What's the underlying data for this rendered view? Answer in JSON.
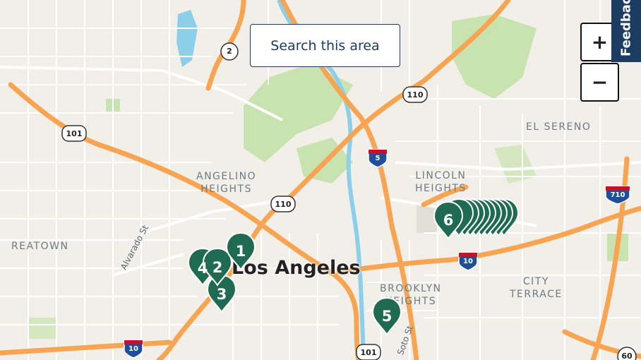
{
  "search_button": {
    "label": "Search this area"
  },
  "zoom": {
    "in_label": "+",
    "out_label": "−"
  },
  "feedback": {
    "label": "Feedback"
  },
  "city_label": "Los Angeles",
  "neighborhoods": [
    {
      "line1": "EL SERENO",
      "line2": ""
    },
    {
      "line1": "ANGELINO",
      "line2": "HEIGHTS"
    },
    {
      "line1": "LINCOLN",
      "line2": "HEIGHTS"
    },
    {
      "line1": "BROOKLYN",
      "line2": "HEIGHTS"
    },
    {
      "line1": "CITY",
      "line2": "TERRACE"
    },
    {
      "line1": "REATOWN",
      "line2": ""
    }
  ],
  "streets": [
    "Alvarado St",
    "Soto St"
  ],
  "highway_shields": [
    "2",
    "101",
    "110",
    "5",
    "110",
    "10",
    "710",
    "10",
    "101",
    "60"
  ],
  "markers": [
    {
      "label": "1",
      "color": "#1f6b52"
    },
    {
      "label": "2",
      "color": "#1f6b52"
    },
    {
      "label": "3",
      "color": "#1f6b52"
    },
    {
      "label": "4",
      "color": "#1f6b52"
    },
    {
      "label": "5",
      "color": "#1f6b52"
    },
    {
      "label": "6",
      "color": "#1f6b52"
    }
  ],
  "colors": {
    "land": "#f2efe9",
    "park": "#c9e3b0",
    "water": "#8ccfea",
    "freeway": "#f7a552",
    "road": "#ffffff",
    "accent": "#1c3c63"
  }
}
